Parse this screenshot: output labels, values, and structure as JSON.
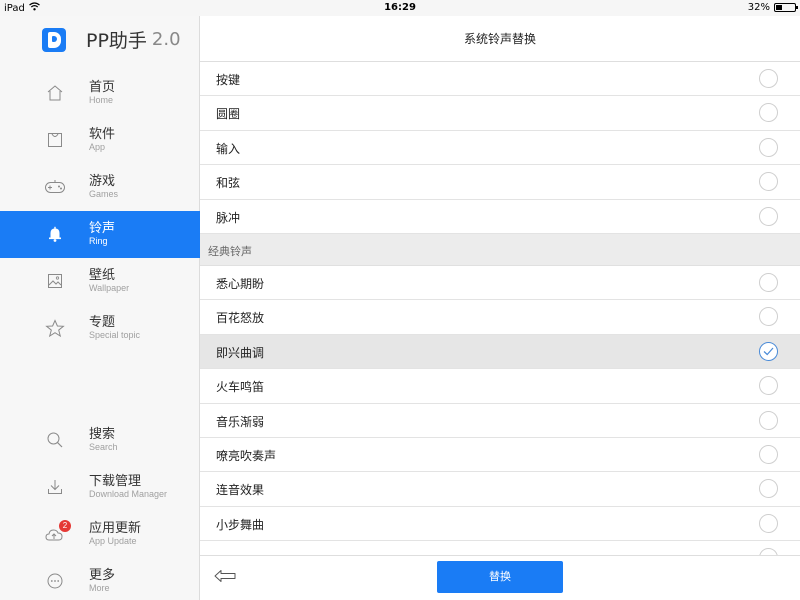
{
  "status_bar": {
    "device": "iPad",
    "time": "16:29",
    "battery": "32%",
    "battery_level": 0.32
  },
  "app": {
    "name": "PP助手",
    "version": "2.0"
  },
  "nav": {
    "top": [
      {
        "zh": "首页",
        "en": "Home",
        "icon": "home-icon"
      },
      {
        "zh": "软件",
        "en": "App",
        "icon": "app-bag-icon"
      },
      {
        "zh": "游戏",
        "en": "Games",
        "icon": "gamepad-icon"
      },
      {
        "zh": "铃声",
        "en": "Ring",
        "icon": "bell-icon",
        "active": true
      },
      {
        "zh": "壁纸",
        "en": "Wallpaper",
        "icon": "image-icon"
      },
      {
        "zh": "专题",
        "en": "Special topic",
        "icon": "star-icon"
      }
    ],
    "bottom": [
      {
        "zh": "搜索",
        "en": "Search",
        "icon": "search-icon"
      },
      {
        "zh": "下载管理",
        "en": "Download Manager",
        "icon": "download-icon"
      },
      {
        "zh": "应用更新",
        "en": "App Update",
        "icon": "cloud-update-icon",
        "badge": "2"
      },
      {
        "zh": "更多",
        "en": "More",
        "icon": "more-icon"
      }
    ]
  },
  "main": {
    "title": "系统铃声替换",
    "rows_top": [
      "按键",
      "圆圈",
      "输入",
      "和弦",
      "脉冲"
    ],
    "section_label": "经典铃声",
    "rows_classic": [
      "悉心期盼",
      "百花怒放",
      "即兴曲调",
      "火车鸣笛",
      "音乐渐弱",
      "嘹亮吹奏声",
      "连音效果",
      "小步舞曲"
    ],
    "selected": "即兴曲调",
    "replace_button": "替换"
  },
  "colors": {
    "accent": "#1a7cf5",
    "badge": "#e53935",
    "selected_row": "#e6e6e6"
  }
}
